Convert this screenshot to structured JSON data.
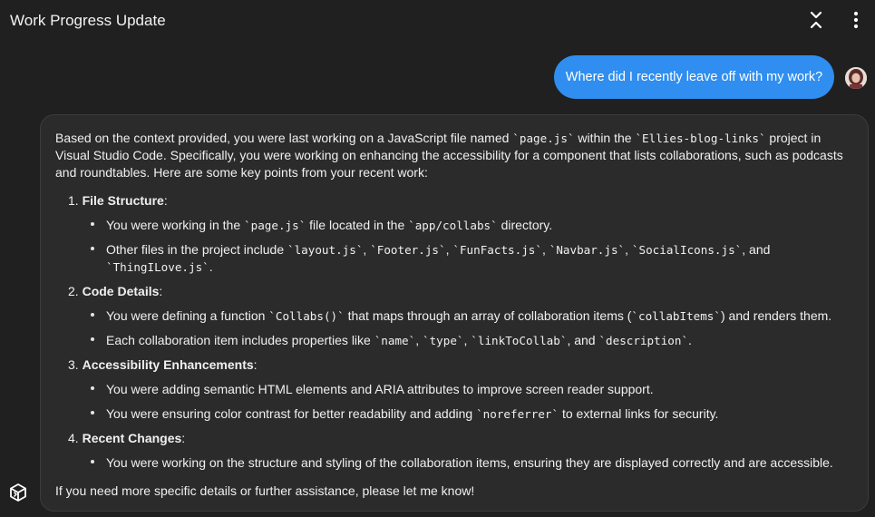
{
  "header": {
    "title": "Work Progress Update"
  },
  "user_message": {
    "text": "Where did I recently leave off with my work?"
  },
  "response": {
    "intro": {
      "line1": {
        "a": "Based on the context provided, you were last working on a JavaScript file named ",
        "code1": "`page.js`",
        "b": " within the ",
        "code2": "`Ellies-blog-links`",
        "c": " project in"
      },
      "line2": "Visual Studio Code. Specifically, you were working on enhancing the accessibility for a component that lists collaborations, such as podcasts",
      "line3": "and roundtables. Here are some key points from your recent work:"
    },
    "sections": [
      {
        "num": "1.",
        "heading": "File Structure",
        "colon": ":",
        "items": [
          {
            "a": "You were working in the ",
            "code1": "`page.js`",
            "b": " file located in the ",
            "code2": "`app/collabs`",
            "c": " directory."
          },
          {
            "a": "Other files in the project include ",
            "code1": "`layout.js`",
            "s1": ", ",
            "code2": "`Footer.js`",
            "s2": ", ",
            "code3": "`FunFacts.js`",
            "s3": ", ",
            "code4": "`Navbar.js`",
            "s4": ", ",
            "code5": "`SocialIcons.js`",
            "s5": ", and",
            "code6": "`ThingILove.js`",
            "end": "."
          }
        ]
      },
      {
        "num": "2.",
        "heading": "Code Details",
        "colon": ":",
        "items": [
          {
            "a": "You were defining a function ",
            "code1": "`Collabs()`",
            "b": " that maps through an array of collaboration items (",
            "code2": "`collabItems`",
            "c": ") and renders them."
          },
          {
            "a": "Each collaboration item includes properties like ",
            "code1": "`name`",
            "s1": ", ",
            "code2": "`type`",
            "s2": ", ",
            "code3": "`linkToCollab`",
            "s3": ", and ",
            "code4": "`description`",
            "end": "."
          }
        ]
      },
      {
        "num": "3.",
        "heading": "Accessibility Enhancements",
        "colon": ":",
        "items": [
          {
            "a": "You were adding semantic HTML elements and ARIA attributes to improve screen reader support."
          },
          {
            "a": "You were ensuring color contrast for better readability and adding ",
            "code1": "`noreferrer`",
            "b": " to external links for security."
          }
        ]
      },
      {
        "num": "4.",
        "heading": "Recent Changes",
        "colon": ":",
        "items": [
          {
            "a": "You were working on the structure and styling of the collaboration items, ensuring they are displayed correctly and are accessible."
          }
        ]
      }
    ],
    "closing": "If you need more specific details or further assistance, please let me know!"
  },
  "icons": {
    "collapse": "collapse-icon",
    "menu": "more-vertical-icon",
    "avatar": "user-avatar",
    "assistant": "assistant-logo-icon"
  },
  "colors": {
    "background": "#202020",
    "card": "#2b2b2b",
    "user_bubble": "#2f8ef0",
    "text": "#f0f0f0"
  }
}
